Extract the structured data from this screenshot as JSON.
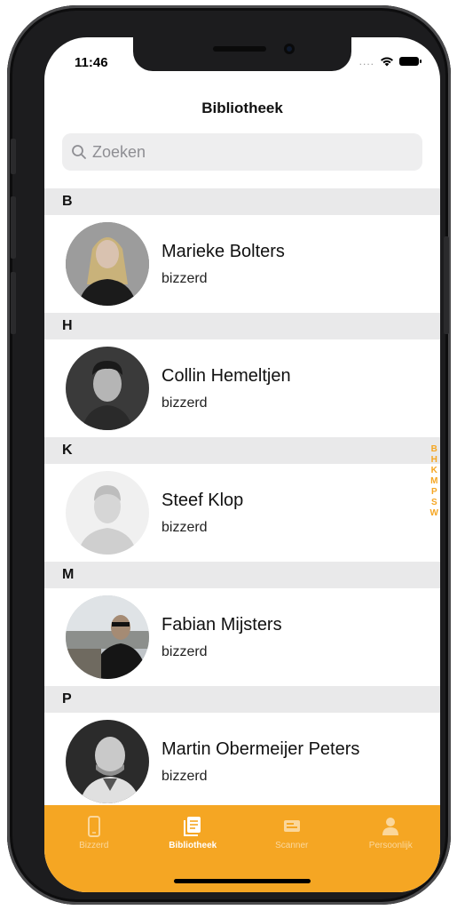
{
  "status": {
    "time": "11:46",
    "signal": "...."
  },
  "nav": {
    "title": "Bibliotheek"
  },
  "search": {
    "placeholder": "Zoeken"
  },
  "sections": [
    {
      "letter": "B",
      "contact": {
        "name": "Marieke Bolters",
        "subtitle": "bizzerd"
      }
    },
    {
      "letter": "H",
      "contact": {
        "name": "Collin Hemeltjen",
        "subtitle": "bizzerd"
      }
    },
    {
      "letter": "K",
      "contact": {
        "name": "Steef Klop",
        "subtitle": "bizzerd"
      }
    },
    {
      "letter": "M",
      "contact": {
        "name": "Fabian Mijsters",
        "subtitle": "bizzerd"
      }
    },
    {
      "letter": "P",
      "contact": {
        "name": "Martin Obermeijer Peters",
        "subtitle": "bizzerd"
      }
    }
  ],
  "index_letters": [
    "B",
    "H",
    "K",
    "M",
    "P",
    "S",
    "W"
  ],
  "tabs": [
    {
      "label": "Bizzerd",
      "icon": "phone-icon",
      "active": false
    },
    {
      "label": "Bibliotheek",
      "icon": "library-icon",
      "active": true
    },
    {
      "label": "Scanner",
      "icon": "scanner-icon",
      "active": false
    },
    {
      "label": "Persoonlijk",
      "icon": "person-icon",
      "active": false
    }
  ],
  "colors": {
    "accent": "#f5a623",
    "section_bg": "#e9e9ea",
    "search_bg": "#eeeeef"
  }
}
